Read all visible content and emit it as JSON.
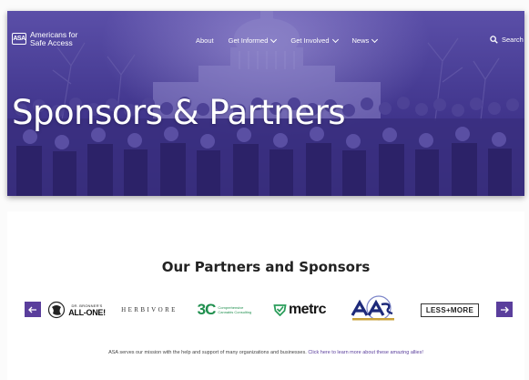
{
  "header": {
    "logo_line1": "Americans for",
    "logo_line2": "Safe Access",
    "logo_mark": "ASA",
    "nav": [
      {
        "label": "About",
        "has_dropdown": false
      },
      {
        "label": "Get Informed",
        "has_dropdown": true
      },
      {
        "label": "Get Involved",
        "has_dropdown": true
      },
      {
        "label": "News",
        "has_dropdown": true
      }
    ],
    "search_label": "Search",
    "search_icon": "search-icon"
  },
  "hero": {
    "title": "Sponsors & Partners"
  },
  "partners": {
    "title": "Our Partners and Sponsors",
    "prev_icon": "arrow-left-icon",
    "next_icon": "arrow-right-icon",
    "logos": [
      {
        "name": "allone",
        "line1": "DR. BRONNER'S",
        "line2": "ALL-ONE!"
      },
      {
        "name": "herbivore",
        "text": "HERBIVORE"
      },
      {
        "name": "3c",
        "big": "3C",
        "small": "Comprehensive Cannabis Consulting"
      },
      {
        "name": "metrc",
        "text": "metrc"
      },
      {
        "name": "asa",
        "text": "ASA"
      },
      {
        "name": "lessmore",
        "text": "LESS+MORE"
      }
    ],
    "note_text": "ASA serves our mission with the help and support of many organizations and businesses. ",
    "note_link": "Click here to learn more about these amazing allies!"
  },
  "colors": {
    "brand_purple": "#5a3e9c",
    "hero_overlay": "#4a3f97",
    "metrc_green": "#2a9d5a",
    "three_c_green": "#1f8f4e"
  }
}
